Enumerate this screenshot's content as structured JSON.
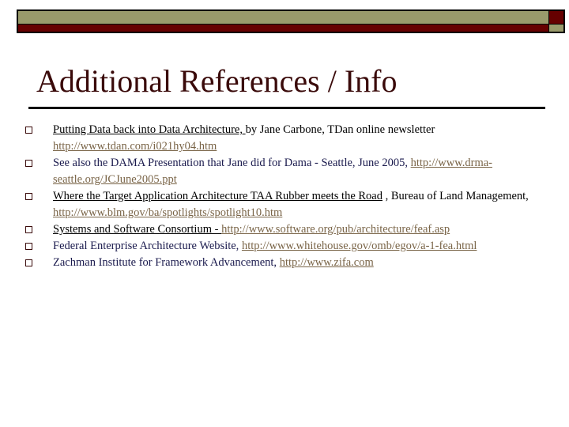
{
  "colors": {
    "olive": "#999a6b",
    "maroon": "#660000",
    "title": "#3a0a0a",
    "link": "#7a6548",
    "navy_text": "#1a1a4d"
  },
  "slide": {
    "title": "Additional References / Info",
    "items": [
      {
        "title": "Putting Data back into Data Architecture, ",
        "text": " by Jane Carbone, TDan online newsletter ",
        "url": "http://www.tdan.com/i021hy04.htm"
      },
      {
        "text": "See also the DAMA Presentation that Jane did for Dama - Seattle, June 2005, ",
        "url": "http://www.drma-seattle.org/JCJune2005.ppt"
      },
      {
        "title": "Where the Target Application Architecture TAA Rubber meets the Road",
        "text": " , Bureau of Land Management, ",
        "url": "http://www.blm.gov/ba/spotlights/spotlight10.htm "
      },
      {
        "title": "Systems and Software Consortium - ",
        "text": " ",
        "url": "http://www.software.org/pub/architecture/feaf.asp"
      },
      {
        "text": "Federal Enterprise Architecture Website, ",
        "url": "http://www.whitehouse.gov/omb/egov/a-1-fea.html"
      },
      {
        "text": "Zachman Institute for Framework Advancement, ",
        "url": "http://www.zifa.com"
      }
    ]
  }
}
